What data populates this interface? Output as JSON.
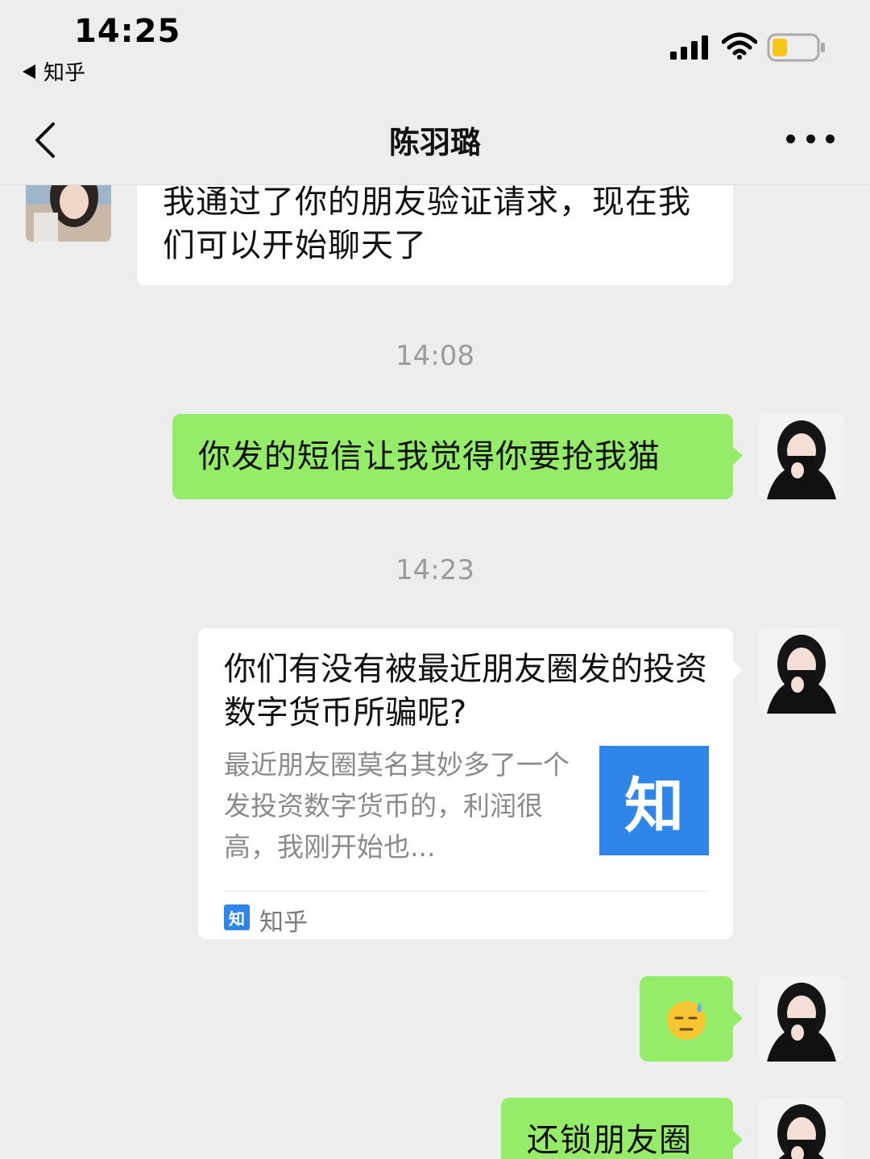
{
  "status_bar": {
    "time": "14:25",
    "back_app": "知乎"
  },
  "nav": {
    "title": "陈羽璐"
  },
  "messages": {
    "first_incoming": "我通过了你的朋友验证请求，现在我们可以开始聊天了",
    "ts1": "14:08",
    "out1": "你发的短信让我觉得你要抢我猫",
    "ts2": "14:23",
    "card": {
      "title": "你们有没有被最近朋友圈发的投资数字货币所骗呢?",
      "desc": "最近朋友圈莫名其妙多了一个发投资数字货币的，利润很高，我刚开始也...",
      "thumb_glyph": "知",
      "source_icon": "知",
      "source_name": "知乎"
    },
    "out_emoji": "😓",
    "out_last": "还锁朋友圈"
  },
  "colors": {
    "background": "#ededed",
    "green_bubble": "#95ec69",
    "zhihu_blue": "#2f86e8",
    "battery_fill": "#f5c518"
  },
  "icons": {
    "back": "chevron-left-icon",
    "more": "more-dots-icon",
    "signal": "signal-icon",
    "wifi": "wifi-icon",
    "battery": "battery-icon"
  }
}
